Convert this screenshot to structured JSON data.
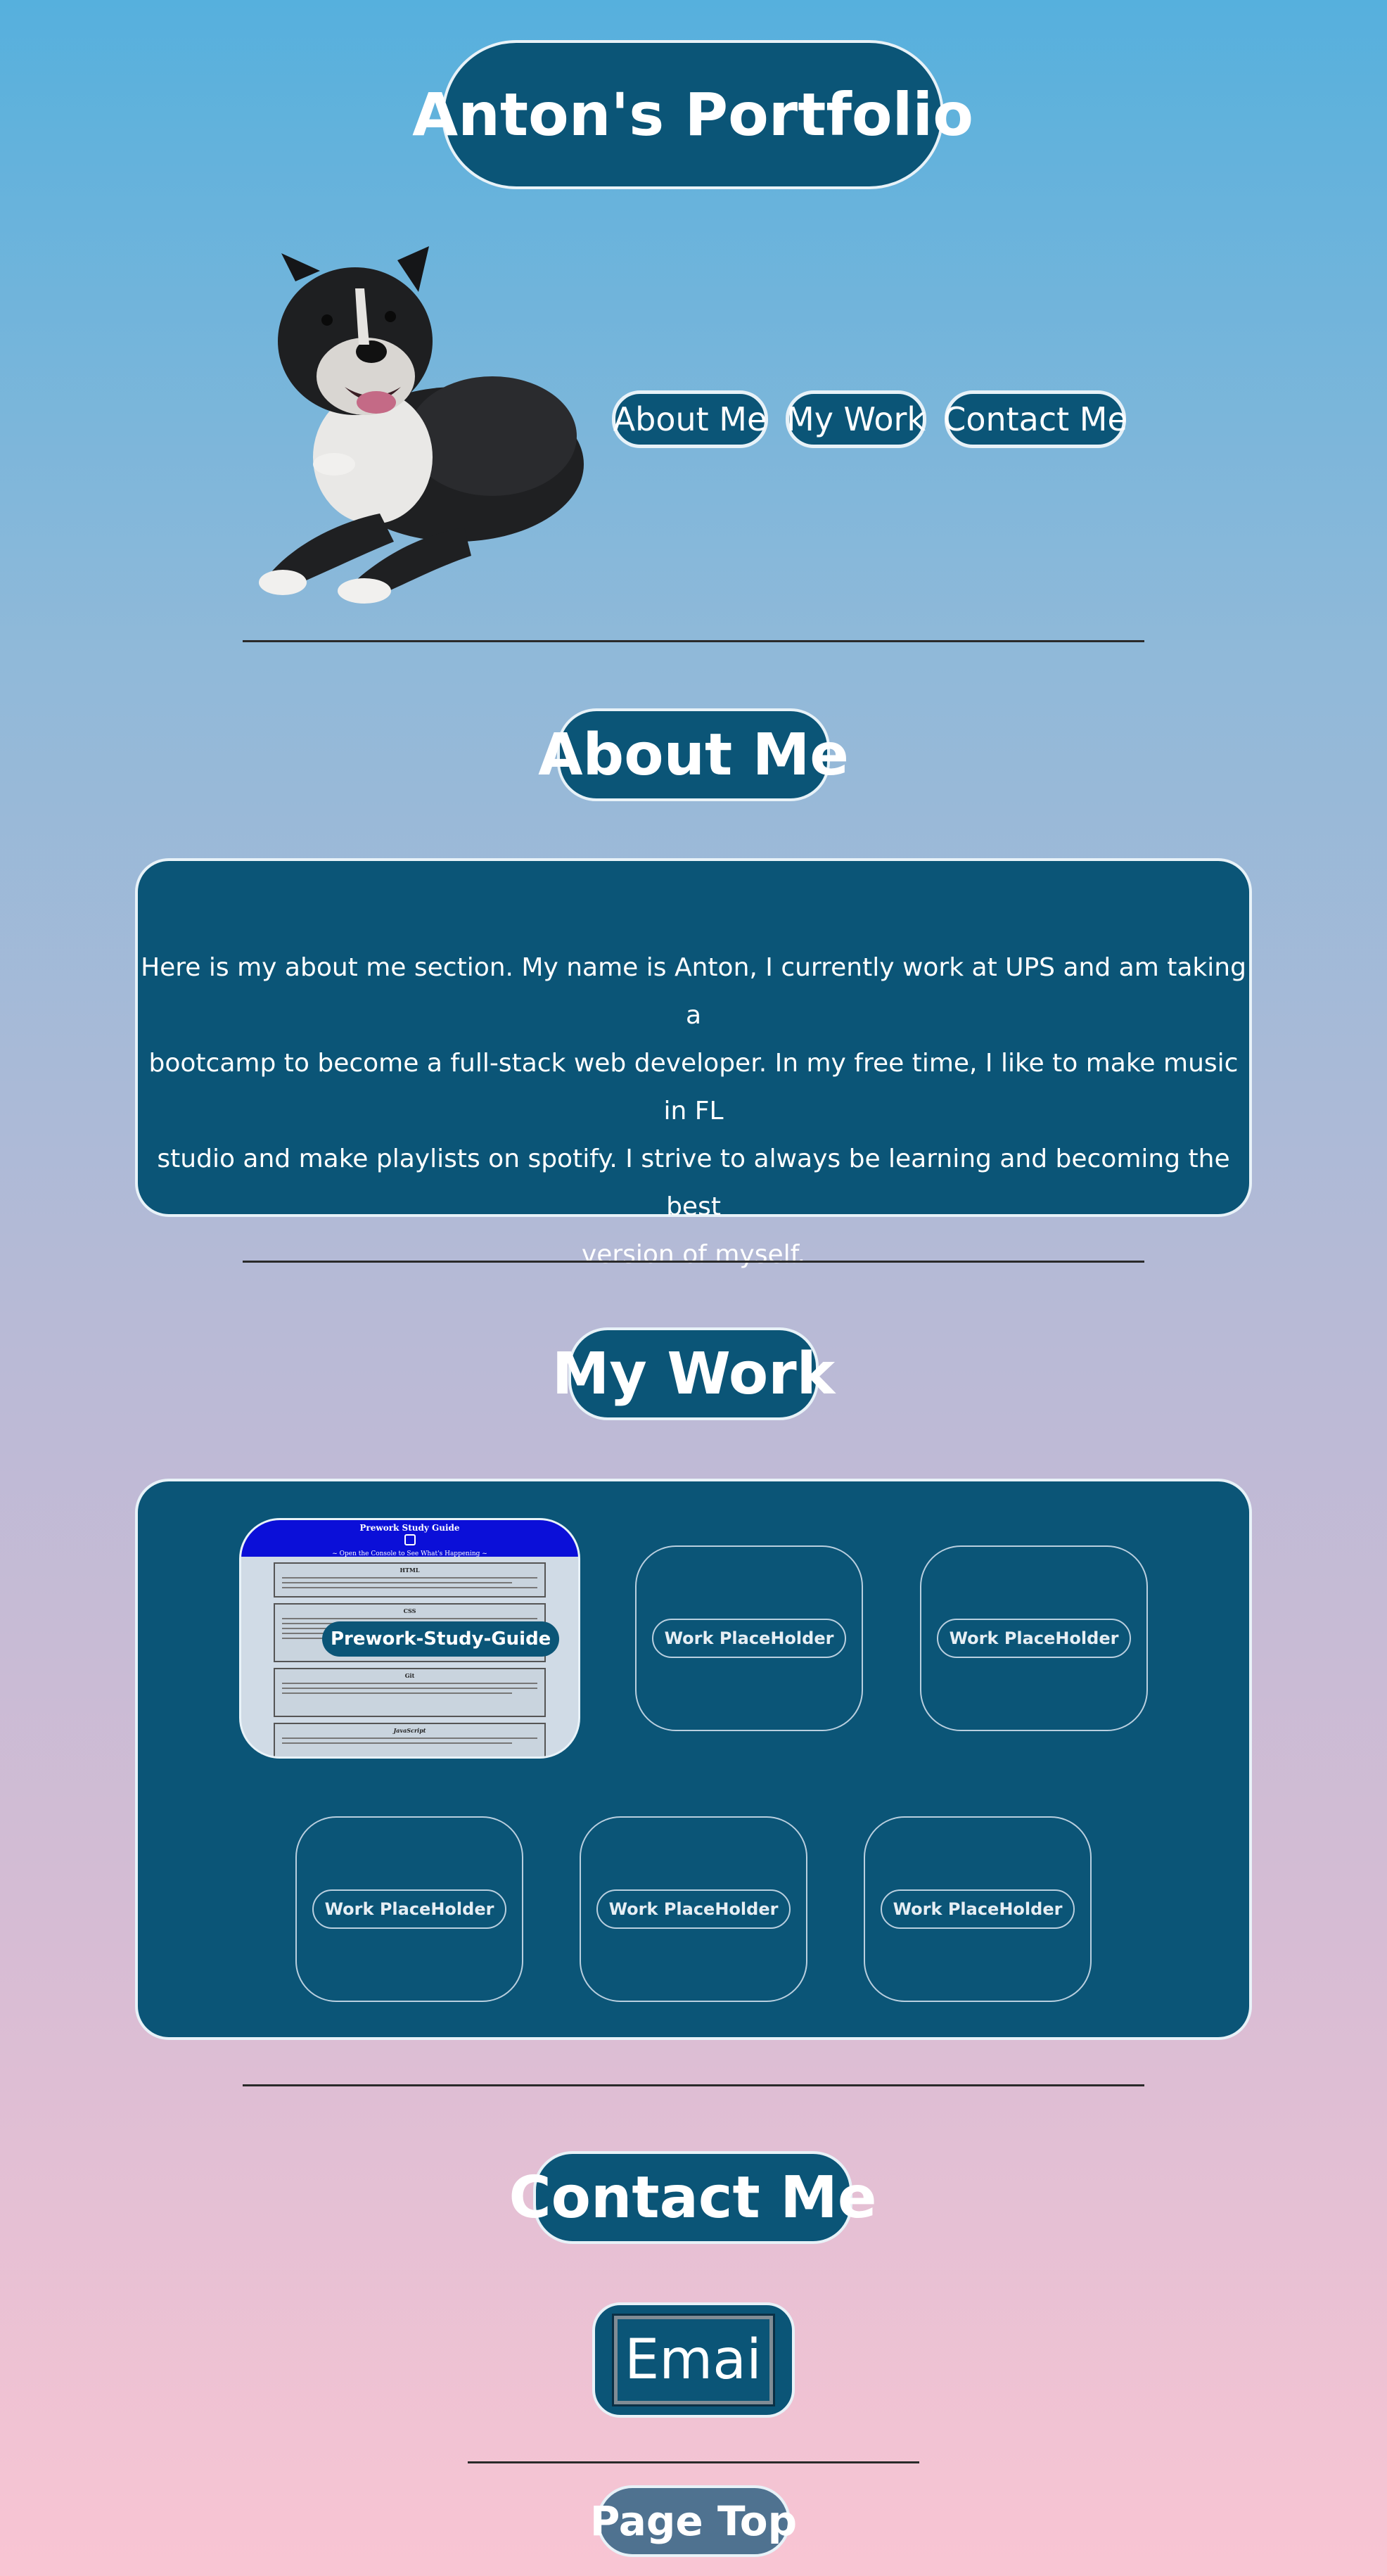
{
  "header": {
    "title": "Anton's Portfolio",
    "avatar_alt": "dog-photo"
  },
  "nav": {
    "items": [
      {
        "label": "About Me"
      },
      {
        "label": "My Work"
      },
      {
        "label": "Contact Me"
      }
    ]
  },
  "about": {
    "heading": "About Me",
    "lines": [
      "Here is my about me section. My name is Anton, I currently work at UPS and am taking a",
      "bootcamp to become a full-stack web developer. In my free time, I like to make music in FL",
      "studio and make playlists on spotify. I strive to always be learning and becoming the best",
      "version of myself."
    ]
  },
  "work": {
    "heading": "My Work",
    "featured": {
      "label": "Prework-Study-Guide",
      "thumb_title": "Prework Study Guide",
      "thumb_subtitle": "~ Open the Console to See What's Happening ~",
      "thumb_sections": [
        "HTML",
        "CSS",
        "Git",
        "JavaScript"
      ]
    },
    "placeholders": [
      {
        "label": "Work PlaceHolder"
      },
      {
        "label": "Work PlaceHolder"
      },
      {
        "label": "Work PlaceHolder"
      },
      {
        "label": "Work PlaceHolder"
      },
      {
        "label": "Work PlaceHolder"
      }
    ]
  },
  "contact": {
    "heading": "Contact Me",
    "email_placeholder": "Email"
  },
  "footer": {
    "page_top": "Page Top"
  },
  "colors": {
    "panel": "#0b5577",
    "page_top": "#4f7290",
    "divider": "#2a2a2a"
  }
}
